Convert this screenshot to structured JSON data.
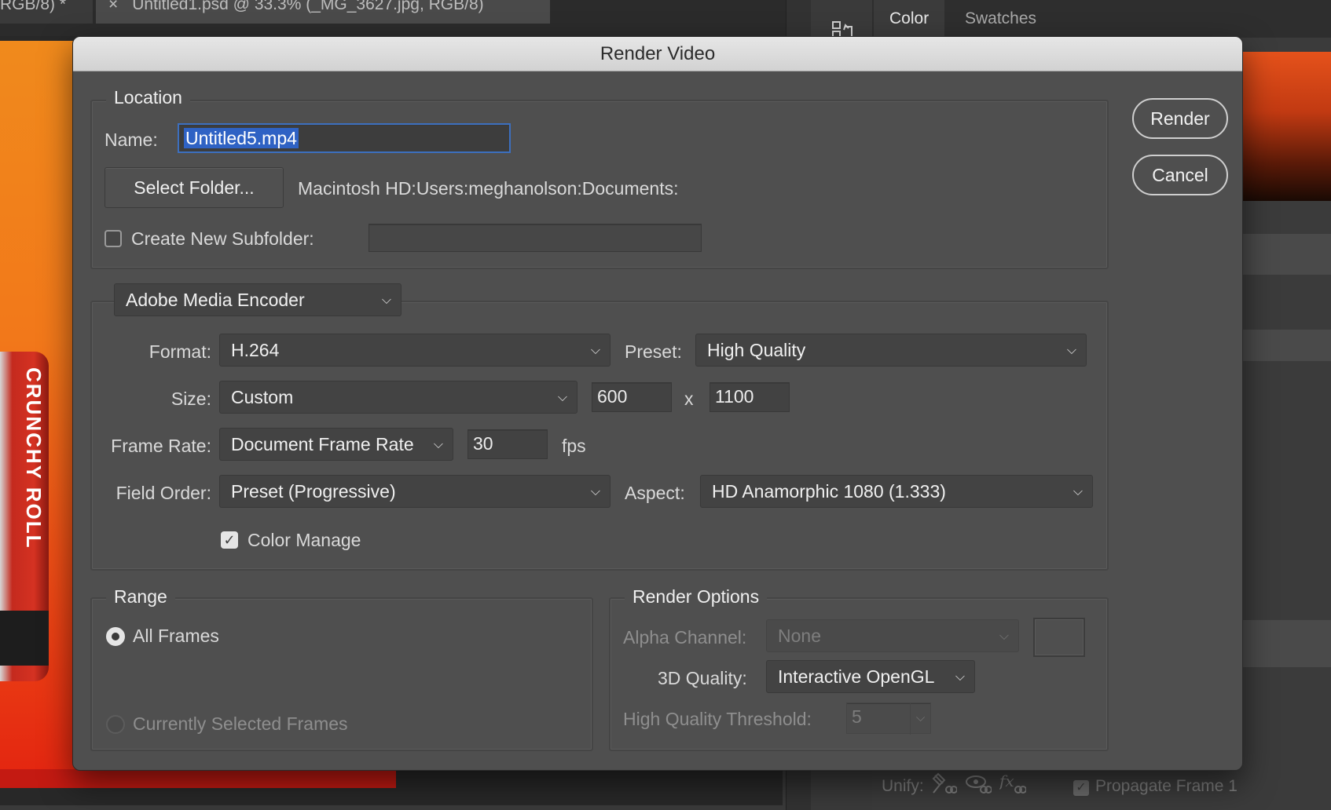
{
  "doc_tabs": {
    "tab1": "RGB/8) *",
    "tab2_close": "×",
    "tab2": "Untitled1.psd @ 33.3% (_MG_3627.jpg, RGB/8)"
  },
  "can_text": "CRUNCHY ROLL",
  "panel": {
    "tab_color": "Color",
    "tab_swatches": "Swatches",
    "footer": {
      "unify_label": "Unify:",
      "propagate_label": "Propagate Frame 1"
    }
  },
  "dialog": {
    "title": "Render Video",
    "buttons": {
      "render": "Render",
      "cancel": "Cancel"
    },
    "location": {
      "legend": "Location",
      "name_label": "Name:",
      "name_value": "Untitled5.mp4",
      "select_folder": "Select Folder...",
      "folder_path": "Macintosh HD:Users:meghanolson:Documents:",
      "subfolder_label": "Create New Subfolder:",
      "subfolder_checked": false,
      "subfolder_value": ""
    },
    "encoder": {
      "selected": "Adobe Media Encoder",
      "format_label": "Format:",
      "format_value": "H.264",
      "preset_label": "Preset:",
      "preset_value": "High Quality",
      "size_label": "Size:",
      "size_value": "Custom",
      "width": "600",
      "size_x": "x",
      "height": "1100",
      "framerate_label": "Frame Rate:",
      "framerate_value": "Document Frame Rate",
      "fps_value": "30",
      "fps_unit": "fps",
      "fieldorder_label": "Field Order:",
      "fieldorder_value": "Preset (Progressive)",
      "aspect_label": "Aspect:",
      "aspect_value": "HD Anamorphic 1080 (1.333)",
      "color_manage_label": "Color Manage",
      "color_manage_checked": true
    },
    "range": {
      "legend": "Range",
      "all_frames": "All Frames",
      "selected_frames": "Currently Selected Frames",
      "selected_option": "All Frames"
    },
    "render_options": {
      "legend": "Render Options",
      "alpha_label": "Alpha Channel:",
      "alpha_value": "None",
      "quality_label": "3D Quality:",
      "quality_value": "Interactive OpenGL",
      "threshold_label": "High Quality Threshold:",
      "threshold_value": "5"
    }
  }
}
